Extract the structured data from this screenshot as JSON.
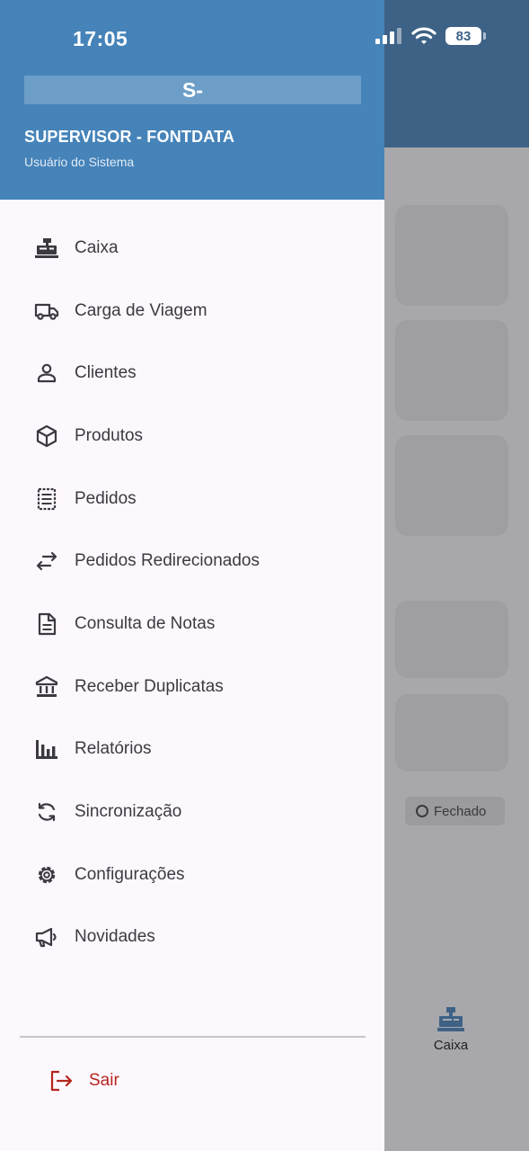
{
  "status_bar": {
    "time": "17:05",
    "battery": "83"
  },
  "drawer": {
    "initials": "S-",
    "user_name": "SUPERVISOR - FONTDATA",
    "user_role": "Usuário do Sistema",
    "menu": [
      {
        "label": "Caixa",
        "icon": "cash-register-icon"
      },
      {
        "label": "Carga de Viagem",
        "icon": "truck-icon"
      },
      {
        "label": "Clientes",
        "icon": "person-icon"
      },
      {
        "label": "Produtos",
        "icon": "box-icon"
      },
      {
        "label": "Pedidos",
        "icon": "receipt-icon"
      },
      {
        "label": "Pedidos Redirecionados",
        "icon": "swap-arrows-icon"
      },
      {
        "label": "Consulta de Notas",
        "icon": "document-icon"
      },
      {
        "label": "Receber Duplicatas",
        "icon": "bank-icon"
      },
      {
        "label": "Relatórios",
        "icon": "bar-chart-icon"
      },
      {
        "label": "Sincronização",
        "icon": "sync-icon"
      },
      {
        "label": "Configurações",
        "icon": "gear-icon"
      },
      {
        "label": "Novidades",
        "icon": "megaphone-icon"
      }
    ],
    "logout_label": "Sair",
    "colors": {
      "header": "#4583b9",
      "logout": "#b3261e",
      "text": "#3c3a41"
    }
  },
  "background": {
    "status_chip": "Fechado",
    "tab_label": "Caixa"
  }
}
